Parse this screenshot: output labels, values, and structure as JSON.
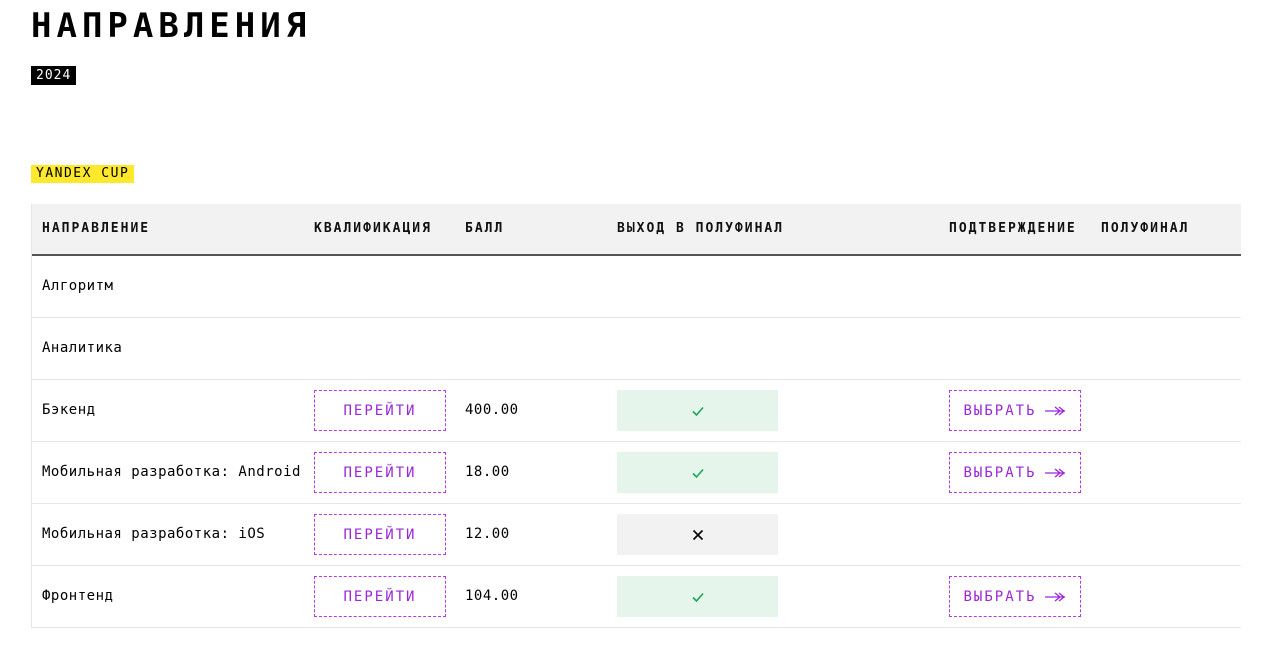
{
  "page": {
    "title": "НАПРАВЛЕНИЯ",
    "year": "2024",
    "section": "YANDEX CUP"
  },
  "table": {
    "headers": {
      "direction": "НАПРАВЛЕНИЕ",
      "qualification": "КВАЛИФИКАЦИЯ",
      "score": "БАЛЛ",
      "semifinal_access": "ВЫХОД В ПОЛУФИНАЛ",
      "confirmation": "ПОДТВЕРЖДЕНИЕ",
      "semifinal": "ПОЛУФИНАЛ"
    },
    "go_label": "ПЕРЕЙТИ",
    "choose_label": "ВЫБРАТЬ",
    "rows": [
      {
        "name": "Алгоритм"
      },
      {
        "name": "Аналитика"
      },
      {
        "name": "Бэкенд",
        "score": "400.00",
        "status": "check-icon",
        "choose": true
      },
      {
        "name": "Мобильная разработка: Android",
        "score": "18.00",
        "status": "check-icon",
        "choose": true
      },
      {
        "name": "Мобильная разработка: iOS",
        "score": "12.00",
        "status": "cross-icon",
        "choose": false
      },
      {
        "name": "Фронтенд",
        "score": "104.00",
        "status": "check-icon",
        "choose": true
      }
    ]
  },
  "colors": {
    "accent": "#9b27d9",
    "highlight": "#fde82b",
    "success_bg": "#e6f5ec",
    "success_icon": "#1fa35a",
    "neutral_bg": "#f2f2f2"
  }
}
